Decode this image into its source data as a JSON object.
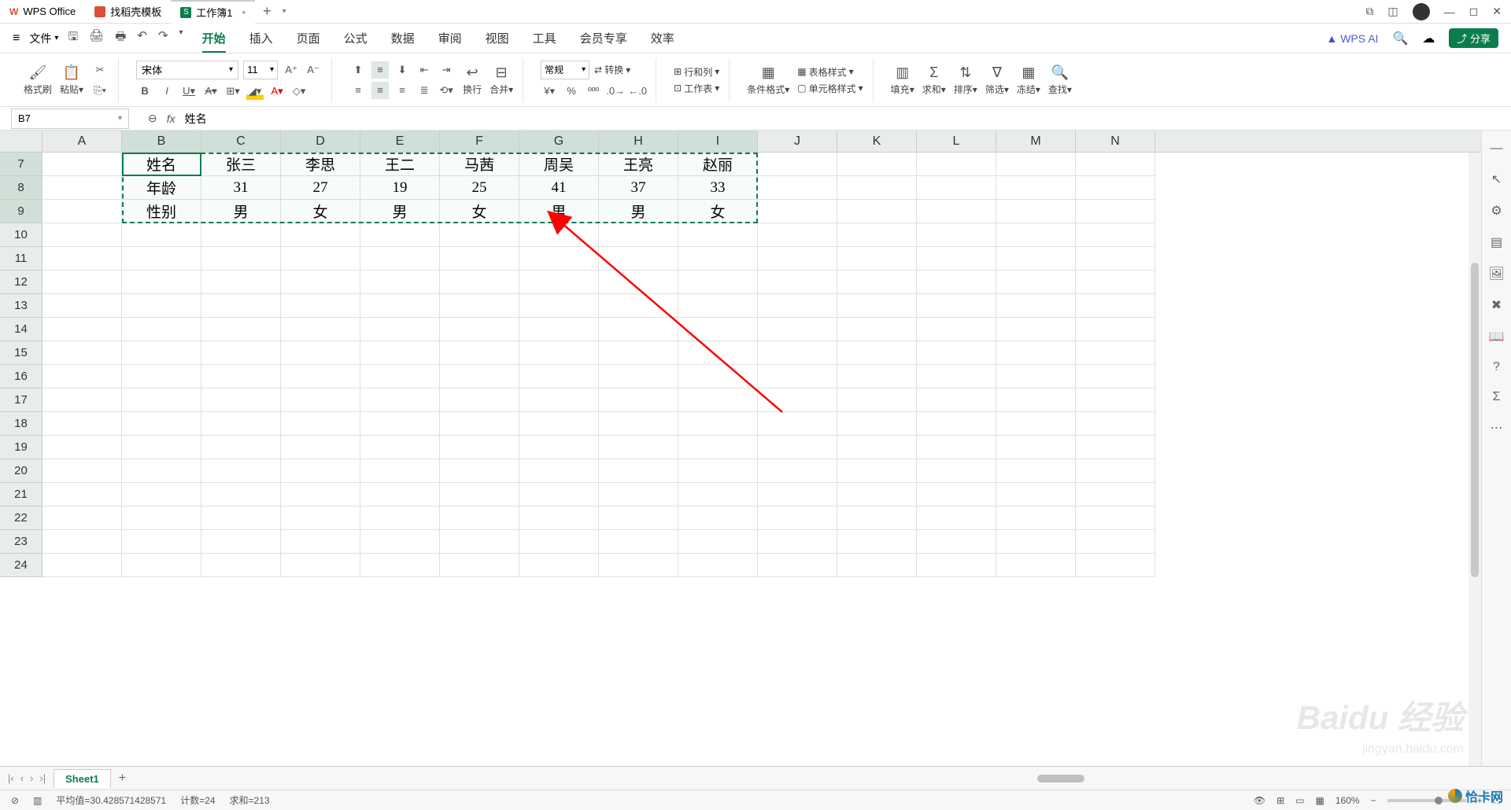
{
  "titleBar": {
    "app": "WPS Office",
    "tab2": "找稻壳模板",
    "tab3": "工作簿1",
    "tab3_mod": "•",
    "add": "+"
  },
  "menu": {
    "file": "文件",
    "tabs": [
      "开始",
      "插入",
      "页面",
      "公式",
      "数据",
      "审阅",
      "视图",
      "工具",
      "会员专享",
      "效率"
    ],
    "ai": "WPS AI",
    "share": "分享"
  },
  "ribbon": {
    "formatBrush": "格式刷",
    "paste": "粘贴",
    "font": "宋体",
    "size": "11",
    "wrap": "换行",
    "merge": "合并",
    "numFormat": "常规",
    "convert": "转换",
    "rowCol": "行和列",
    "worksheet": "工作表",
    "condFmt": "条件格式",
    "tableStyle": "表格样式",
    "cellStyle": "单元格样式",
    "fill": "填充",
    "sum": "求和",
    "sort": "排序",
    "filter": "筛选",
    "freeze": "冻结",
    "find": "查找"
  },
  "nameBox": "B7",
  "formula": "姓名",
  "columns": [
    "A",
    "B",
    "C",
    "D",
    "E",
    "F",
    "G",
    "H",
    "I",
    "J",
    "K",
    "L",
    "M",
    "N"
  ],
  "rowNumbers": [
    7,
    8,
    9,
    10,
    11,
    12,
    13,
    14,
    15,
    16,
    17,
    18,
    19,
    20,
    21,
    22,
    23,
    24
  ],
  "data": {
    "r7": [
      "",
      "姓名",
      "张三",
      "李思",
      "王二",
      "马茜",
      "周吴",
      "王亮",
      "赵丽",
      "",
      "",
      "",
      "",
      ""
    ],
    "r8": [
      "",
      "年龄",
      "31",
      "27",
      "19",
      "25",
      "41",
      "37",
      "33",
      "",
      "",
      "",
      "",
      ""
    ],
    "r9": [
      "",
      "性别",
      "男",
      "女",
      "男",
      "女",
      "男",
      "男",
      "女",
      "",
      "",
      "",
      "",
      ""
    ]
  },
  "sheetTab": "Sheet1",
  "status": {
    "avg": "平均值=30.428571428571",
    "count": "计数=24",
    "sum": "求和=213",
    "zoom": "160%"
  },
  "watermark": "Baidu 经验",
  "watermarkSub": "jingyan.baidu.com",
  "qiaka": "恰卡网"
}
